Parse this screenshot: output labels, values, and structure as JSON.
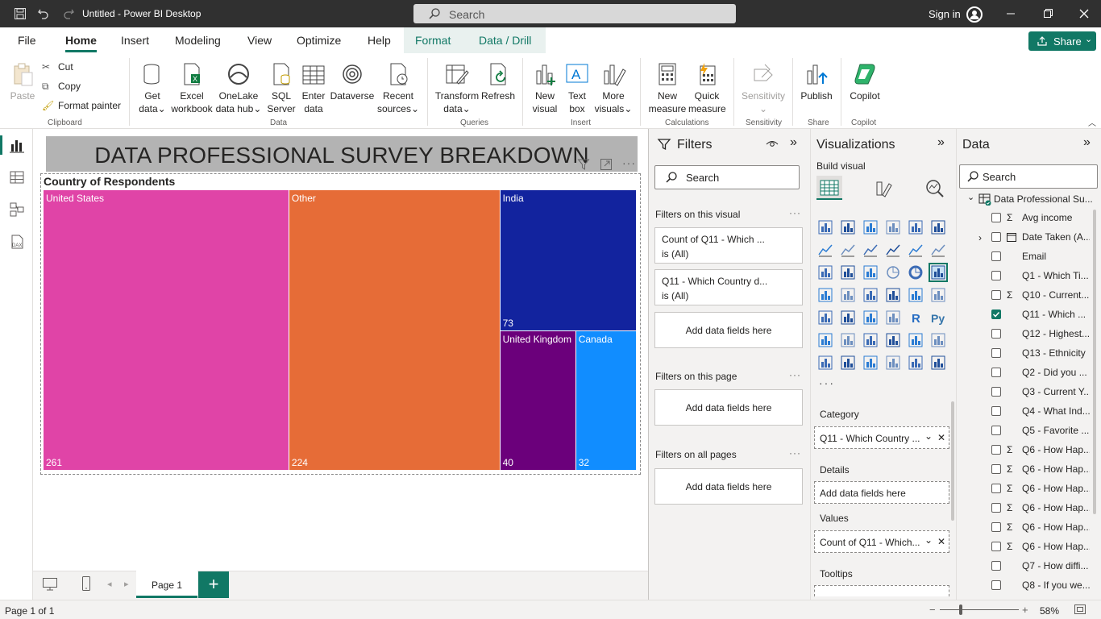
{
  "window": {
    "title": "Untitled - Power BI Desktop",
    "search_placeholder": "Search",
    "signin": "Sign in"
  },
  "menu": [
    "File",
    "Home",
    "Insert",
    "Modeling",
    "View",
    "Optimize",
    "Help",
    "Format",
    "Data / Drill"
  ],
  "share_label": "Share",
  "ribbon": {
    "clipboard": {
      "paste": "Paste",
      "cut": "Cut",
      "copy": "Copy",
      "format_painter": "Format painter",
      "group": "Clipboard"
    },
    "data": {
      "get_data": [
        "Get",
        "data"
      ],
      "excel": [
        "Excel",
        "workbook"
      ],
      "onelake": [
        "OneLake",
        "data hub"
      ],
      "sql": [
        "SQL",
        "Server"
      ],
      "enter": [
        "Enter",
        "data"
      ],
      "dataverse": "Dataverse",
      "recent": [
        "Recent",
        "sources"
      ],
      "group": "Data"
    },
    "queries": {
      "transform": [
        "Transform",
        "data"
      ],
      "refresh": "Refresh",
      "group": "Queries"
    },
    "insert": {
      "new_visual": [
        "New",
        "visual"
      ],
      "text_box": [
        "Text",
        "box"
      ],
      "more_visuals": [
        "More",
        "visuals"
      ],
      "group": "Insert"
    },
    "calculations": {
      "new_measure": [
        "New",
        "measure"
      ],
      "quick_measure": [
        "Quick",
        "measure"
      ],
      "group": "Calculations"
    },
    "sensitivity": {
      "label": "Sensitivity",
      "group": "Sensitivity"
    },
    "share": {
      "publish": "Publish",
      "group": "Share"
    },
    "copilot": {
      "label": "Copilot",
      "group": "Copilot"
    }
  },
  "report": {
    "title_card": "DATA PROFESSIONAL SURVEY BREAKDOWN",
    "visual_title": "Country of Respondents"
  },
  "chart_data": {
    "type": "treemap",
    "title": "Country of Respondents",
    "categories": [
      "United States",
      "Other",
      "India",
      "United Kingdom",
      "Canada"
    ],
    "values": [
      261,
      224,
      73,
      40,
      32
    ],
    "colors": [
      "#e044a7",
      "#e66c37",
      "#12239e",
      "#6b007b",
      "#118dff"
    ]
  },
  "pages": {
    "tab": "Page 1",
    "status": "Page 1 of 1",
    "zoom": "58%"
  },
  "filters": {
    "title": "Filters",
    "search": "Search",
    "on_visual": "Filters on this visual",
    "cards": [
      {
        "line1": "Count of Q11 - Which ...",
        "line2": "is (All)"
      },
      {
        "line1": "Q11 - Which Country d...",
        "line2": "is (All)"
      }
    ],
    "add_fields": "Add data fields here",
    "on_page": "Filters on this page",
    "on_all": "Filters on all pages"
  },
  "visualizations": {
    "title": "Visualizations",
    "build": "Build visual",
    "wells": {
      "category_label": "Category",
      "category_value": "Q11 - Which Country ...",
      "details_label": "Details",
      "details_value": "Add data fields here",
      "values_label": "Values",
      "values_value": "Count of Q11 - Which...",
      "tooltips_label": "Tooltips"
    }
  },
  "data_pane": {
    "title": "Data",
    "search": "Search",
    "table": "Data Professional Su...",
    "fields": [
      {
        "name": "Avg income",
        "sigma": true,
        "checked": false
      },
      {
        "name": "Date Taken (A...",
        "sigma": false,
        "checked": false,
        "expand": true
      },
      {
        "name": "Email",
        "sigma": false,
        "checked": false
      },
      {
        "name": "Q1 - Which Ti...",
        "sigma": false,
        "checked": false
      },
      {
        "name": "Q10 - Current...",
        "sigma": true,
        "checked": false
      },
      {
        "name": "Q11 - Which ...",
        "sigma": false,
        "checked": true
      },
      {
        "name": "Q12 - Highest...",
        "sigma": false,
        "checked": false
      },
      {
        "name": "Q13 - Ethnicity",
        "sigma": false,
        "checked": false
      },
      {
        "name": "Q2 - Did you ...",
        "sigma": false,
        "checked": false
      },
      {
        "name": "Q3 - Current Y...",
        "sigma": false,
        "checked": false
      },
      {
        "name": "Q4 - What Ind...",
        "sigma": false,
        "checked": false
      },
      {
        "name": "Q5 - Favorite ...",
        "sigma": false,
        "checked": false
      },
      {
        "name": "Q6 - How Hap...",
        "sigma": true,
        "checked": false
      },
      {
        "name": "Q6 - How Hap...",
        "sigma": true,
        "checked": false
      },
      {
        "name": "Q6 - How Hap...",
        "sigma": true,
        "checked": false
      },
      {
        "name": "Q6 - How Hap...",
        "sigma": true,
        "checked": false
      },
      {
        "name": "Q6 - How Hap...",
        "sigma": true,
        "checked": false
      },
      {
        "name": "Q6 - How Hap...",
        "sigma": true,
        "checked": false
      },
      {
        "name": "Q7 - How diffi...",
        "sigma": false,
        "checked": false
      },
      {
        "name": "Q8 - If you we...",
        "sigma": false,
        "checked": false
      }
    ]
  }
}
